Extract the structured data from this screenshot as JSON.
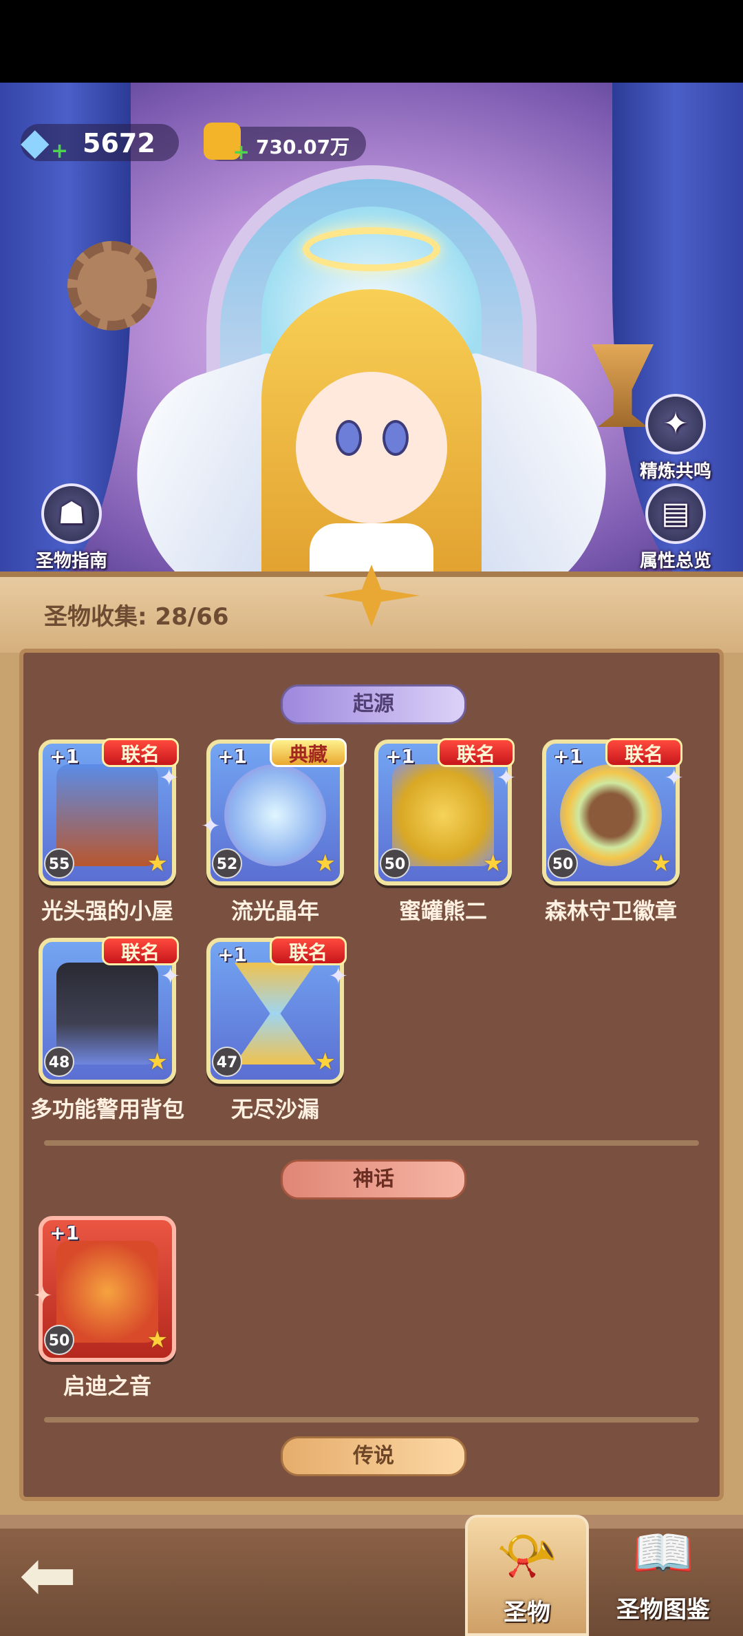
{
  "currency": {
    "diamonds": "5672",
    "coins": "730.07万"
  },
  "side_buttons": {
    "guide": "圣物指南",
    "resonance": "精炼共鸣",
    "attributes": "属性总览"
  },
  "collection": {
    "label": "圣物收集: 28/66"
  },
  "categories": {
    "origin": "起源",
    "myth": "神话",
    "legend": "传说"
  },
  "relics": [
    {
      "name": "光头强的小屋",
      "plus": "+1",
      "tag": "联名",
      "level": "55"
    },
    {
      "name": "流光晶年",
      "plus": "+1",
      "tag": "典藏",
      "level": "52"
    },
    {
      "name": "蜜罐熊二",
      "plus": "+1",
      "tag": "联名",
      "level": "50"
    },
    {
      "name": "森林守卫徽章",
      "plus": "+1",
      "tag": "联名",
      "level": "50"
    },
    {
      "name": "多功能警用背包",
      "plus": "",
      "tag": "联名",
      "level": "48"
    },
    {
      "name": "无尽沙漏",
      "plus": "+1",
      "tag": "联名",
      "level": "47"
    },
    {
      "name": "启迪之音",
      "plus": "+1",
      "tag": "",
      "level": "50"
    }
  ],
  "tabs": {
    "relics": "圣物",
    "codex": "圣物图鉴"
  }
}
